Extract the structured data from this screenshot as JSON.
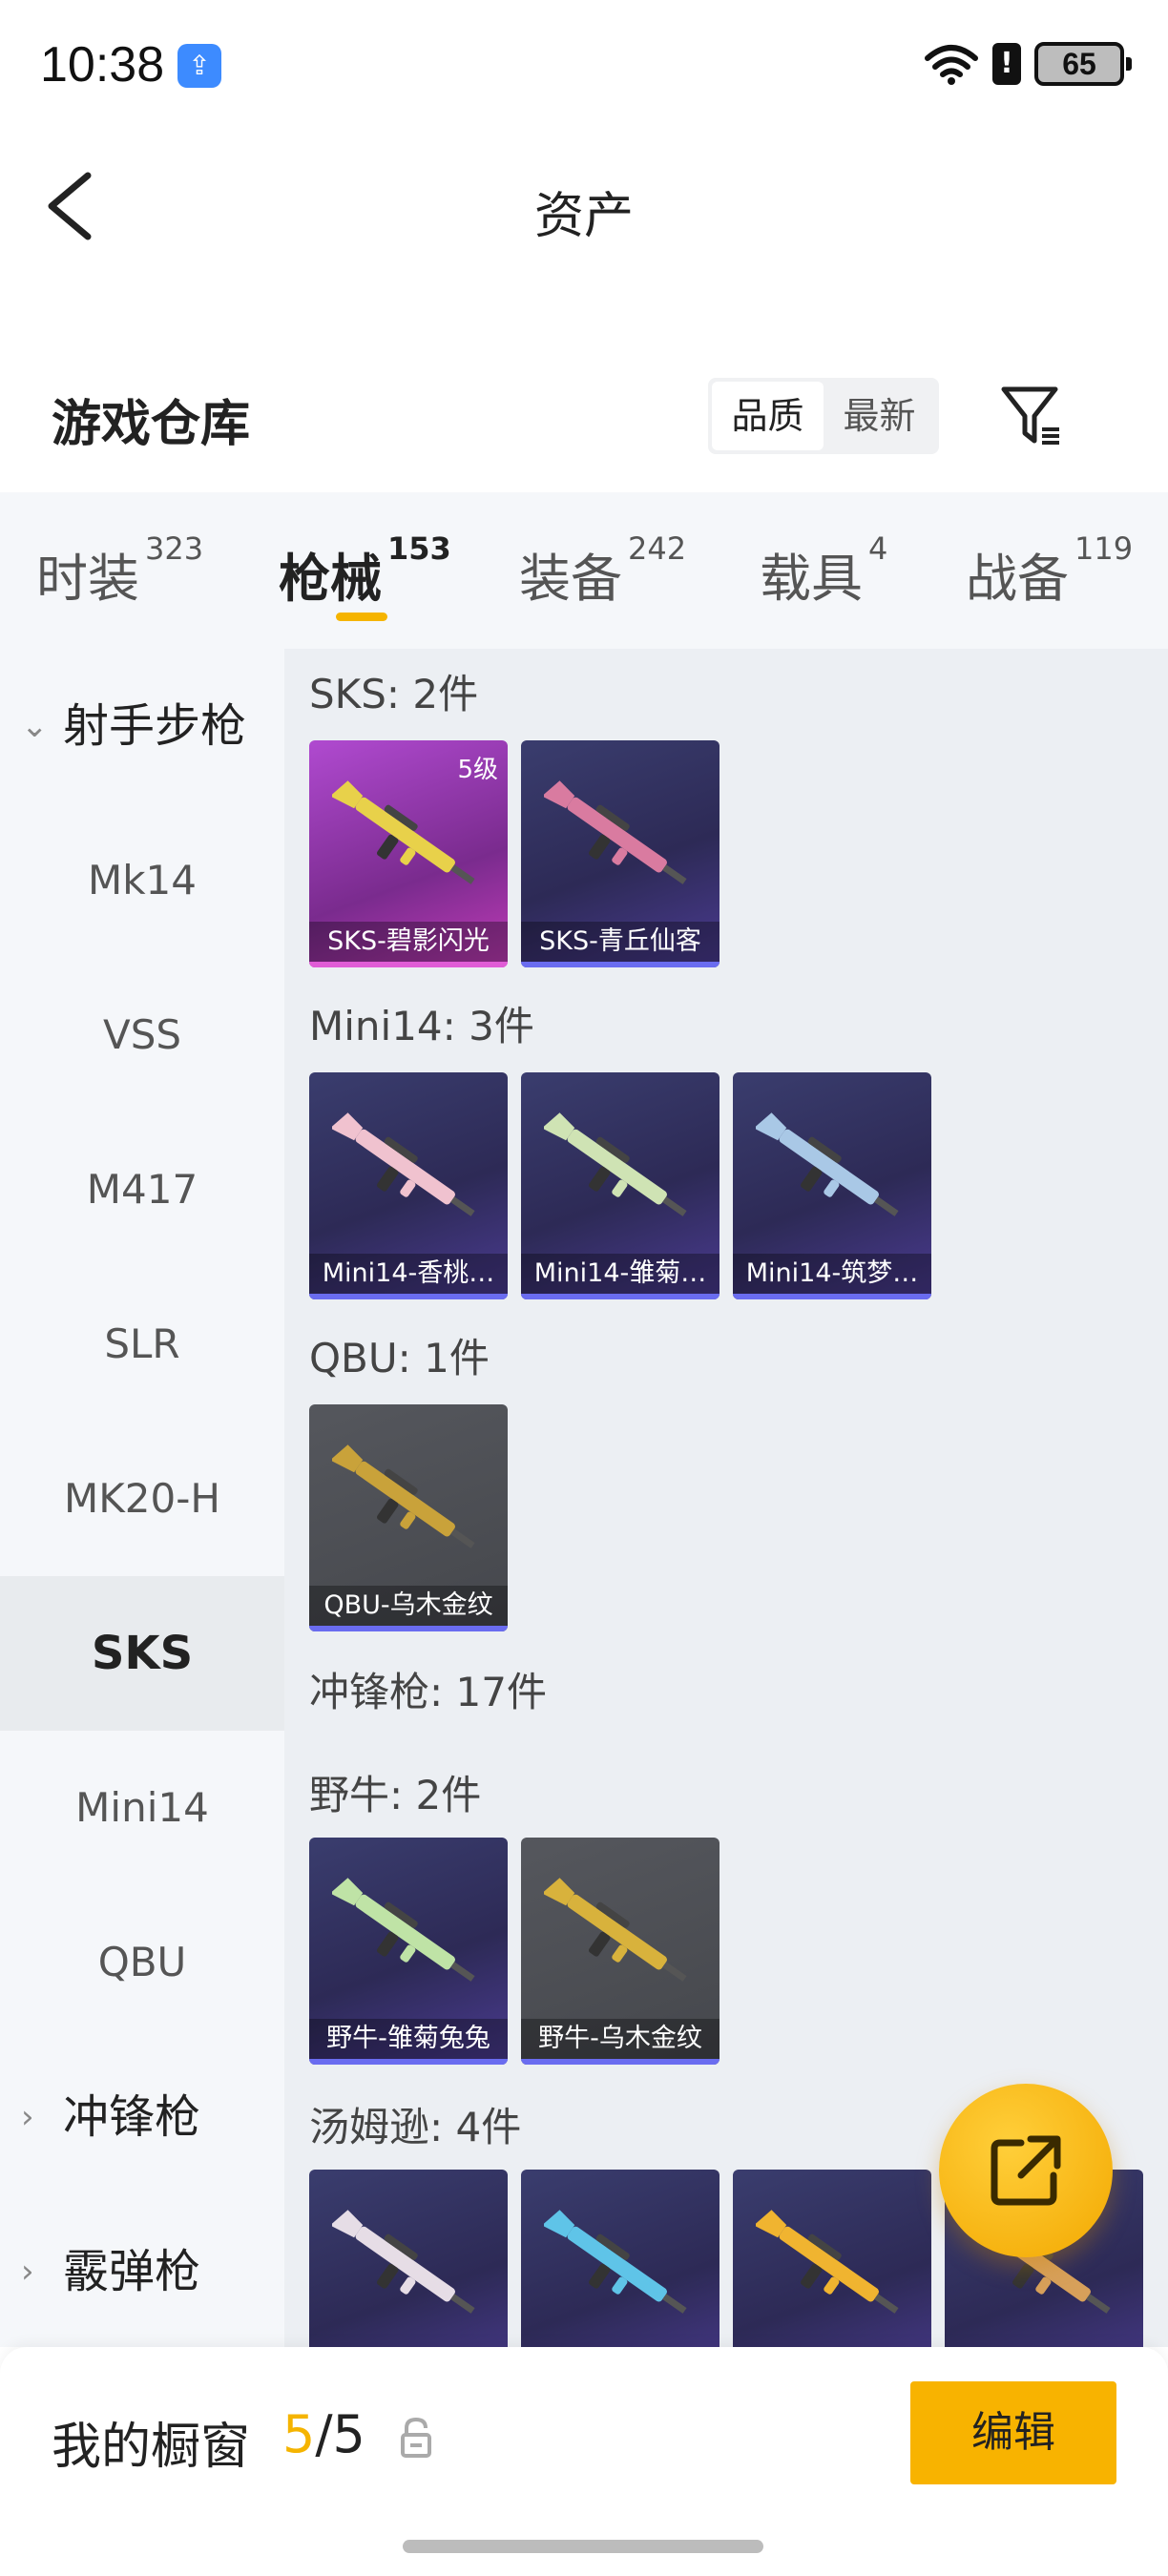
{
  "status_bar": {
    "time": "10:38",
    "battery": "65",
    "alert": "!"
  },
  "header": {
    "title": "资产"
  },
  "warehouse": {
    "title": "游戏仓库",
    "sort_options": [
      "品质",
      "最新"
    ],
    "sort_selected": "品质"
  },
  "tabs": [
    {
      "label": "时装",
      "count": "323",
      "active": false
    },
    {
      "label": "枪械",
      "count": "153",
      "active": true
    },
    {
      "label": "装备",
      "count": "242",
      "active": false
    },
    {
      "label": "载具",
      "count": "4",
      "active": false
    },
    {
      "label": "战备",
      "count": "119",
      "active": false
    }
  ],
  "sidebar": {
    "items": [
      {
        "label": "射手步枪",
        "type": "group",
        "chevron": "⌄"
      },
      {
        "label": "Mk14",
        "type": "item"
      },
      {
        "label": "VSS",
        "type": "item"
      },
      {
        "label": "M417",
        "type": "item"
      },
      {
        "label": "SLR",
        "type": "item"
      },
      {
        "label": "MK20-H",
        "type": "item"
      },
      {
        "label": "SKS",
        "type": "item",
        "active": true
      },
      {
        "label": "Mini14",
        "type": "item"
      },
      {
        "label": "QBU",
        "type": "item"
      },
      {
        "label": "冲锋枪",
        "type": "group",
        "chevron": "›"
      },
      {
        "label": "霰弹枪",
        "type": "group",
        "chevron": "›"
      }
    ]
  },
  "content": {
    "groups": [
      {
        "label": "SKS: 2件",
        "cards": [
          {
            "name": "SKS-碧影闪光",
            "level": "5级",
            "rarity": "pink",
            "gun_color": "#e8d14a"
          },
          {
            "name": "SKS-青丘仙客",
            "rarity": "purple",
            "gun_color": "#d97ba0"
          }
        ]
      },
      {
        "label": "Mini14: 3件",
        "cards": [
          {
            "name": "Mini14-香桃…",
            "rarity": "purple",
            "gun_color": "#f0c2cf"
          },
          {
            "name": "Mini14-雏菊…",
            "rarity": "purple",
            "gun_color": "#cfe3b4"
          },
          {
            "name": "Mini14-筑梦…",
            "rarity": "purple",
            "gun_color": "#a9c8e6"
          }
        ]
      },
      {
        "label": "QBU: 1件",
        "cards": [
          {
            "name": "QBU-乌木金纹",
            "rarity": "gray",
            "gun_color": "#c9a23a"
          }
        ]
      },
      {
        "label": "冲锋枪: 17件",
        "cards": []
      },
      {
        "label": "野牛: 2件",
        "cards": [
          {
            "name": "野牛-雏菊兔兔",
            "rarity": "purple",
            "gun_color": "#bfe3a6"
          },
          {
            "name": "野牛-乌木金纹",
            "rarity": "gray",
            "gun_color": "#d8b23c"
          }
        ]
      },
      {
        "label": "汤姆逊: 4件",
        "cards": [
          {
            "name": "",
            "rarity": "purple",
            "gun_color": "#e6dde6"
          },
          {
            "name": "",
            "rarity": "purple",
            "gun_color": "#5fc4e8"
          },
          {
            "name": "",
            "rarity": "purple",
            "gun_color": "#f0b430"
          },
          {
            "name": "",
            "rarity": "purple",
            "gun_color": "#d7a05a"
          }
        ]
      }
    ]
  },
  "showcase": {
    "title": "我的橱窗",
    "current": "5",
    "total": "/5",
    "edit_label": "编辑"
  },
  "colors": {
    "accent": "#f5b400",
    "tab_bg": "#f5f7fa",
    "content_bg": "#eceff3"
  }
}
